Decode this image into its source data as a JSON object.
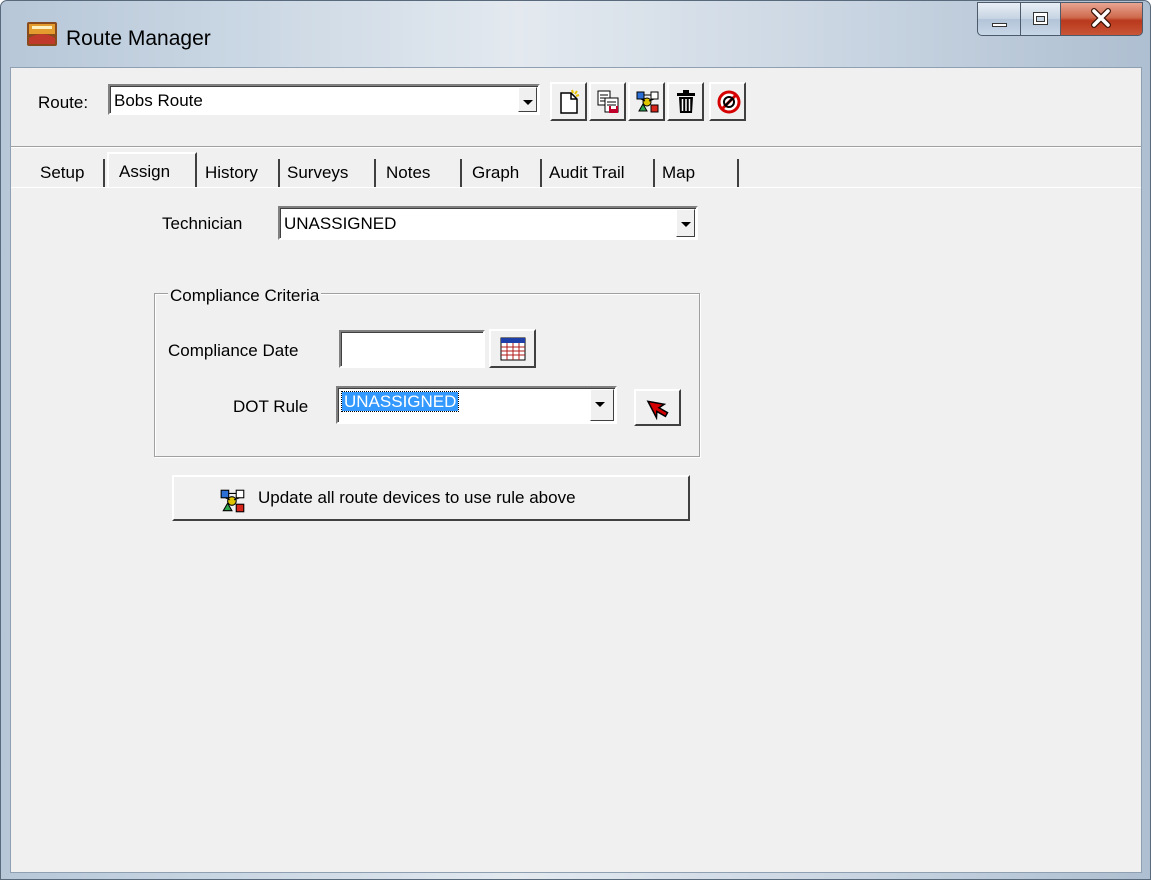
{
  "window": {
    "title": "Route Manager",
    "icon": "route-manager-app-icon"
  },
  "toolbar": {
    "route_label": "Route:",
    "route_value": "Bobs Route",
    "buttons": [
      {
        "icon": "new-document-icon"
      },
      {
        "icon": "save-copy-icon"
      },
      {
        "icon": "devices-icon"
      },
      {
        "icon": "trash-icon"
      },
      {
        "icon": "cancel-icon"
      }
    ]
  },
  "tabs": [
    {
      "label": "Setup",
      "active": false
    },
    {
      "label": "Assign",
      "active": true
    },
    {
      "label": "History",
      "active": false
    },
    {
      "label": "Surveys",
      "active": false
    },
    {
      "label": "Notes",
      "active": false
    },
    {
      "label": "Graph",
      "active": false
    },
    {
      "label": "Audit Trail",
      "active": false
    },
    {
      "label": "Map",
      "active": false
    }
  ],
  "assign": {
    "technician_label": "Technician",
    "technician_value": "UNASSIGNED",
    "compliance": {
      "legend": "Compliance Criteria",
      "date_label": "Compliance Date",
      "date_value": "",
      "dot_rule_label": "DOT Rule",
      "dot_rule_value": "UNASSIGNED"
    },
    "update_button_label": "Update all route devices to use rule above"
  },
  "colors": {
    "selection": "#3399ff",
    "face": "#f0f0f0",
    "close_button": "#c9452a"
  }
}
